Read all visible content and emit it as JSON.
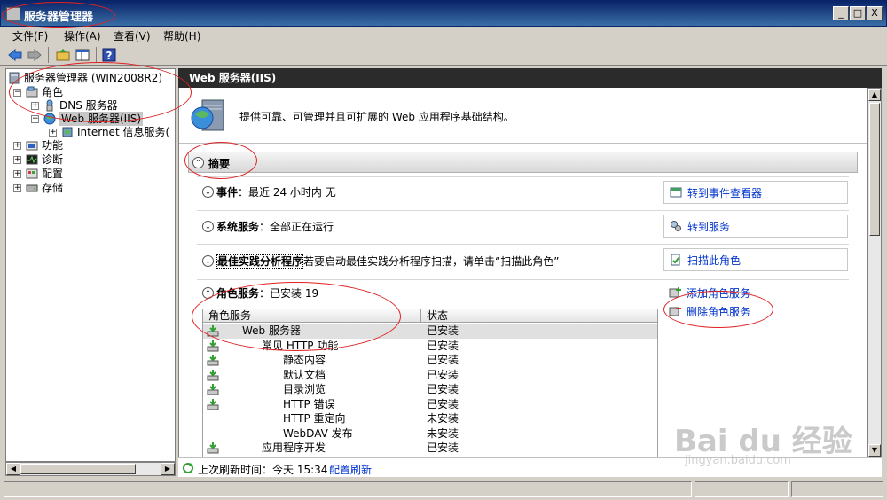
{
  "window": {
    "title": "服务器管理器",
    "controls": {
      "minimize": "_",
      "maximize": "□",
      "close": "X"
    }
  },
  "menu": [
    "文件(F)",
    "操作(A)",
    "查看(V)",
    "帮助(H)"
  ],
  "tree": {
    "root": "服务器管理器 (WIN2008R2)",
    "roles": "角色",
    "dns": "DNS 服务器",
    "web": "Web 服务器(IIS)",
    "iis_mgr": "Internet 信息服务(",
    "features": "功能",
    "diagnostics": "诊断",
    "config": "配置",
    "storage": "存储"
  },
  "right_header": "Web 服务器(IIS)",
  "hero_text": "提供可靠、可管理并且可扩展的 Web 应用程序基础结构。",
  "summary": "摘要",
  "events": {
    "label": "事件",
    "value": "：最近 24 小时内 无",
    "action": "转到事件查看器"
  },
  "services": {
    "label": "系统服务",
    "value": "：全部正在运行",
    "action": "转到服务"
  },
  "bpa": {
    "label": "最佳实践分析程序",
    "value": "若要启动最佳实践分析程序扫描，请单击“扫描此角色”",
    "action": "扫描此角色"
  },
  "role_services": {
    "label": "角色服务",
    "value": "：已安装 19",
    "add_action": "添加角色服务",
    "remove_action": "删除角色服务",
    "col_name": "角色服务",
    "col_state": "状态",
    "rows": [
      {
        "name": "Web 服务器",
        "state": "已安装"
      },
      {
        "name": "常见 HTTP 功能",
        "state": "已安装"
      },
      {
        "name": "静态内容",
        "state": "已安装"
      },
      {
        "name": "默认文档",
        "state": "已安装"
      },
      {
        "name": "目录浏览",
        "state": "已安装"
      },
      {
        "name": "HTTP 错误",
        "state": "已安装"
      },
      {
        "name": "HTTP 重定向",
        "state": "未安装"
      },
      {
        "name": "WebDAV 发布",
        "state": "未安装"
      },
      {
        "name": "应用程序开发",
        "state": "已安装"
      }
    ]
  },
  "refresh": {
    "text": "上次刷新时间：今天 15:34",
    "link": "配置刷新"
  },
  "watermark": {
    "brand": "Bai du 经验",
    "url": "jingyan.baidu.com"
  },
  "colors": {
    "link": "#0033cc",
    "annotation": "#e02020",
    "header_bg": "#2b2b2b"
  }
}
